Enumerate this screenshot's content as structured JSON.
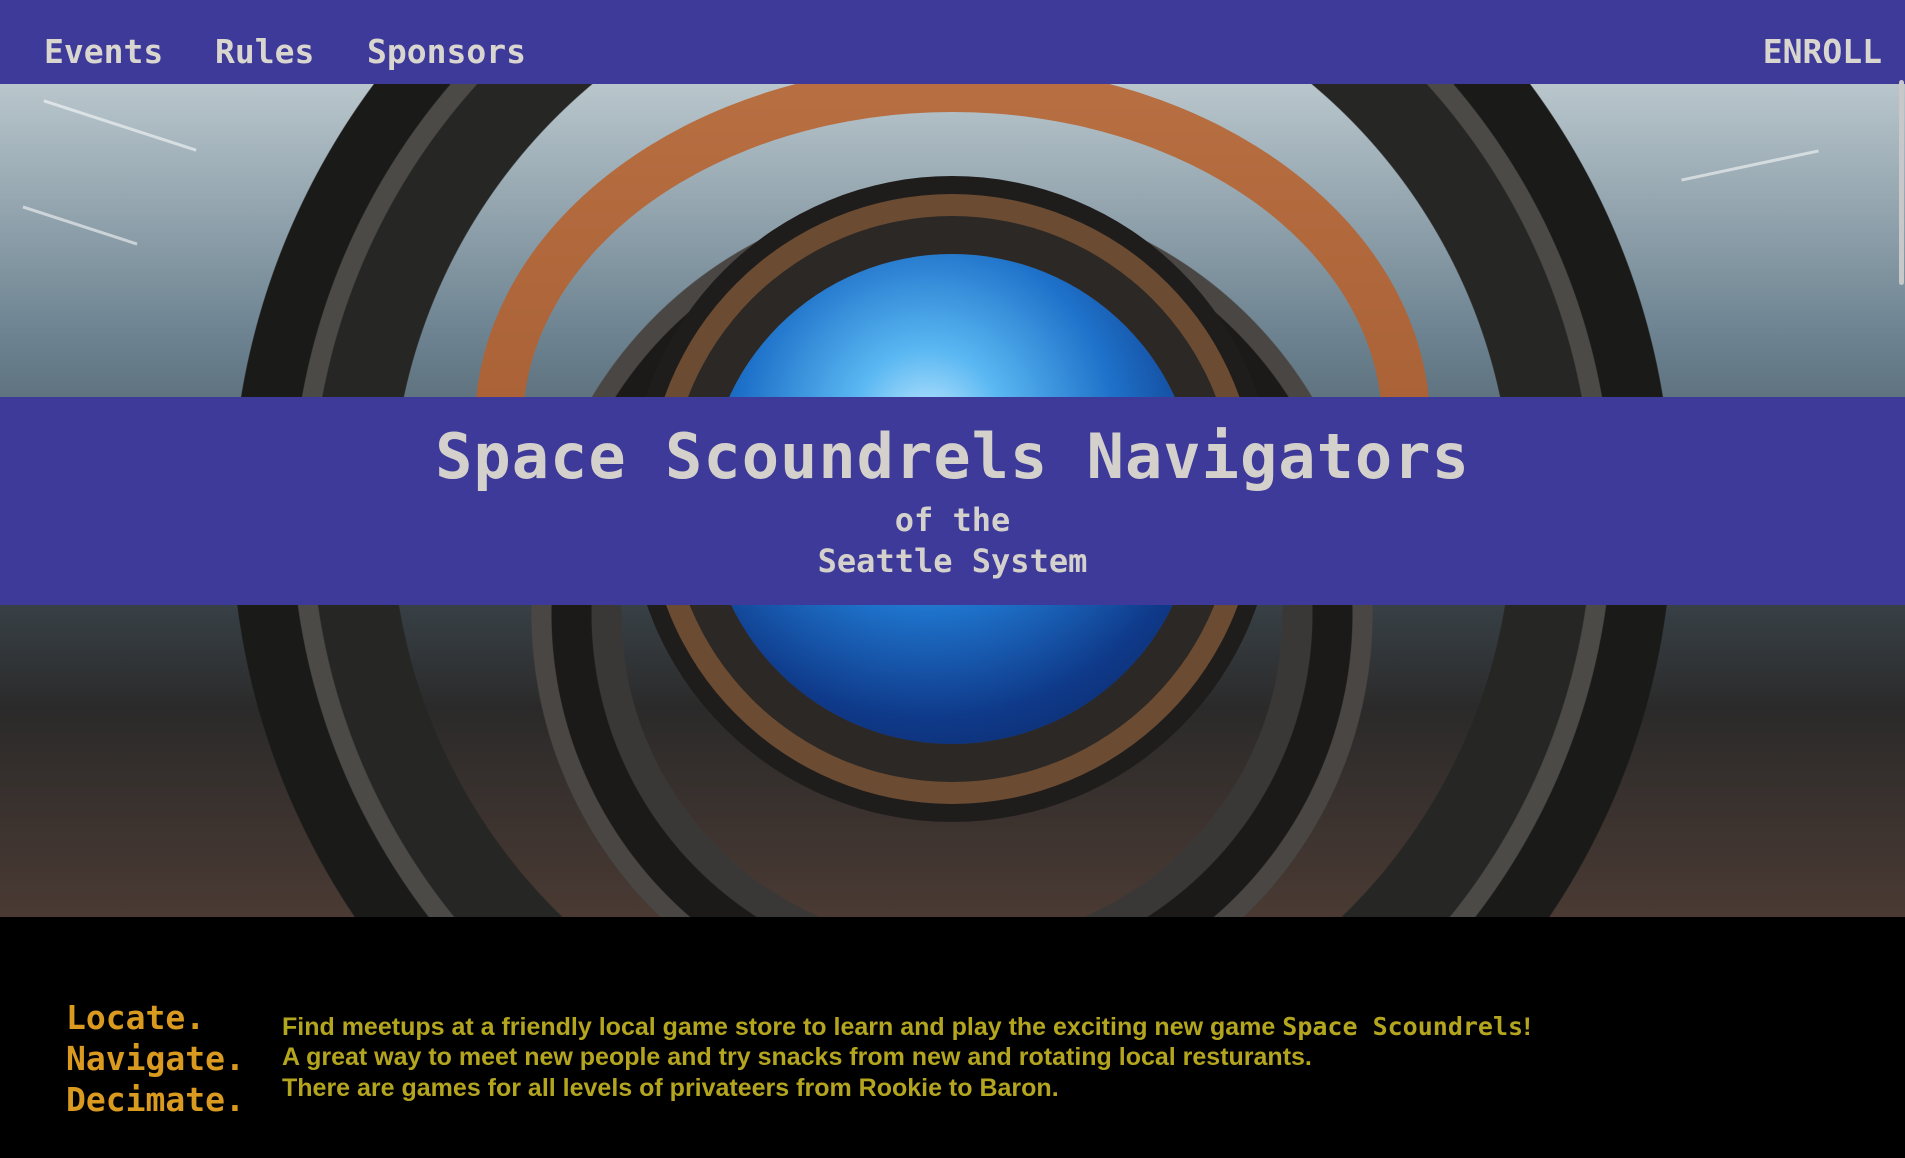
{
  "nav": {
    "events": "Events",
    "rules": "Rules",
    "sponsors": "Sponsors",
    "enroll": "ENROLL"
  },
  "hero": {
    "title": "Space Scoundrels Navigators",
    "subtitle_line1": "of the",
    "subtitle_line2": "Seattle System"
  },
  "slogan": {
    "line1": "Locate.",
    "line2": "Navigate.",
    "line3": "Decimate."
  },
  "description": {
    "line1_prefix": "Find meetups at a friendly local game store to learn and play the exciting new game ",
    "game_name": "Space Scoundrels",
    "line1_suffix": "!",
    "line2": "A great way to meet new people and try snacks from new and rotating local resturants.",
    "line3": "There are games for all levels of privateers from Rookie to Baron."
  },
  "colors": {
    "nav_background": "#3d3a99",
    "nav_text": "#d9d6cf",
    "slogan": "#d99a1f",
    "description": "#b4a51f",
    "page_background": "#000000"
  }
}
